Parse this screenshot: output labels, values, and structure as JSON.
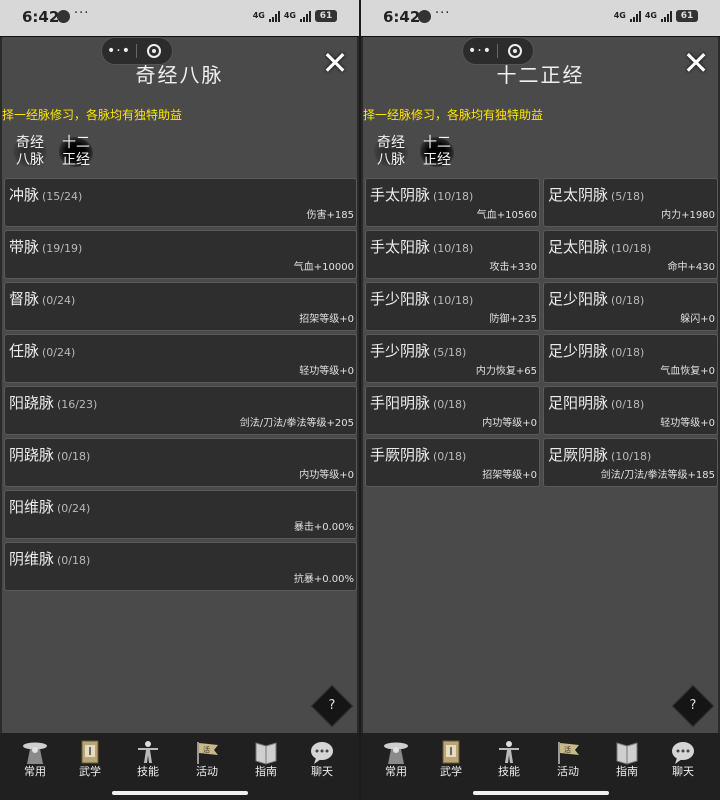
{
  "status_bar": {
    "time": "6:42",
    "dots": "···",
    "net1": "4G",
    "net2": "4G",
    "battery": "61"
  },
  "capsule": {
    "more": "•·•"
  },
  "help_label": "?",
  "left": {
    "title": "奇经八脉",
    "subtitle": "择一经脉修习，各脉均有独特助益",
    "tabs": [
      {
        "label_1": "奇经",
        "label_2": "八脉"
      },
      {
        "label_1": "十二",
        "label_2": "正经"
      }
    ],
    "rows": [
      {
        "name": "冲脉",
        "progress": "(15/24)",
        "bonus": "伤害+185"
      },
      {
        "name": "带脉",
        "progress": "(19/19)",
        "bonus": "气血+10000"
      },
      {
        "name": "督脉",
        "progress": "(0/24)",
        "bonus": "招架等级+0"
      },
      {
        "name": "任脉",
        "progress": "(0/24)",
        "bonus": "轻功等级+0"
      },
      {
        "name": "阳跷脉",
        "progress": "(16/23)",
        "bonus": "剑法/刀法/拳法等级+205"
      },
      {
        "name": "阴跷脉",
        "progress": "(0/18)",
        "bonus": "内功等级+0"
      },
      {
        "name": "阳维脉",
        "progress": "(0/24)",
        "bonus": "暴击+0.00%"
      },
      {
        "name": "阴维脉",
        "progress": "(0/18)",
        "bonus": "抗暴+0.00%"
      }
    ]
  },
  "right": {
    "title": "十二正经",
    "subtitle": "择一经脉修习，各脉均有独特助益",
    "tabs": [
      {
        "label_1": "奇经",
        "label_2": "八脉"
      },
      {
        "label_1": "十二",
        "label_2": "正经"
      }
    ],
    "col_left": [
      {
        "name": "手太阴脉",
        "progress": "(10/18)",
        "bonus": "气血+10560"
      },
      {
        "name": "手太阳脉",
        "progress": "(10/18)",
        "bonus": "攻击+330"
      },
      {
        "name": "手少阳脉",
        "progress": "(10/18)",
        "bonus": "防御+235"
      },
      {
        "name": "手少阴脉",
        "progress": "(5/18)",
        "bonus": "内力恢复+65"
      },
      {
        "name": "手阳明脉",
        "progress": "(0/18)",
        "bonus": "内功等级+0"
      },
      {
        "name": "手厥阴脉",
        "progress": "(0/18)",
        "bonus": "招架等级+0"
      }
    ],
    "col_right": [
      {
        "name": "足太阴脉",
        "progress": "(5/18)",
        "bonus": "内力+1980"
      },
      {
        "name": "足太阳脉",
        "progress": "(10/18)",
        "bonus": "命中+430"
      },
      {
        "name": "足少阳脉",
        "progress": "(0/18)",
        "bonus": "躲闪+0"
      },
      {
        "name": "足少阴脉",
        "progress": "(0/18)",
        "bonus": "气血恢复+0"
      },
      {
        "name": "足阳明脉",
        "progress": "(0/18)",
        "bonus": "轻功等级+0"
      },
      {
        "name": "足厥阴脉",
        "progress": "(10/18)",
        "bonus": "剑法/刀法/拳法等级+185"
      }
    ]
  },
  "nav": [
    {
      "label": "常用",
      "icon": "straw-hat-figure-icon"
    },
    {
      "label": "武学",
      "icon": "scroll-book-icon"
    },
    {
      "label": "技能",
      "icon": "martial-pose-icon"
    },
    {
      "label": "活动",
      "icon": "banner-flag-icon"
    },
    {
      "label": "指南",
      "icon": "open-scroll-icon"
    },
    {
      "label": "聊天",
      "icon": "chat-bubble-icon"
    }
  ]
}
